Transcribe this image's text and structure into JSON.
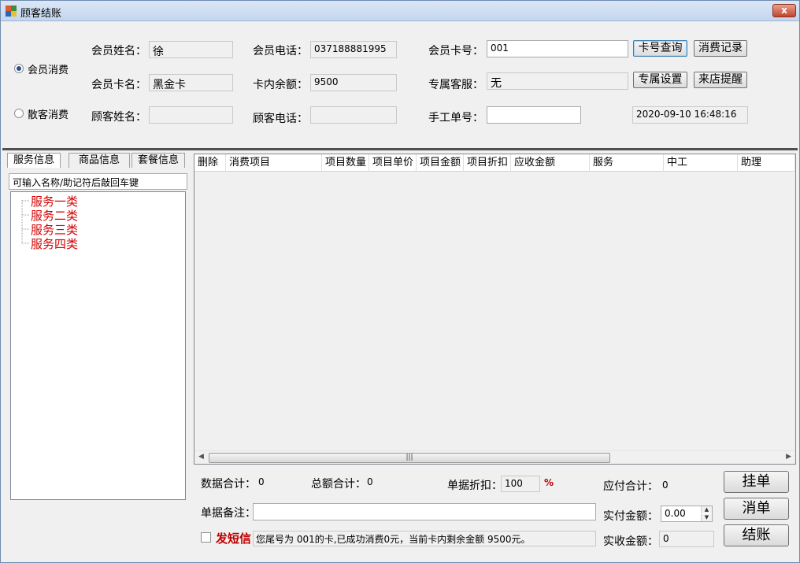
{
  "window": {
    "title": "顾客结账",
    "close_label": "x"
  },
  "mode": {
    "member_label": "会员消费",
    "walkin_label": "散客消费",
    "selected": "member"
  },
  "member": {
    "name_label": "会员姓名：",
    "name": "徐",
    "phone_label": "会员电话：",
    "phone": "037188881995",
    "card_no_label": "会员卡号：",
    "card_no": "001",
    "card_name_label": "会员卡名：",
    "card_name": "黑金卡",
    "balance_label": "卡内余额：",
    "balance": "9500",
    "service_label": "专属客服：",
    "service": "无"
  },
  "customer": {
    "name_label": "顾客姓名：",
    "name": "",
    "phone_label": "顾客电话：",
    "phone": "",
    "manual_label": "手工单号：",
    "manual": ""
  },
  "buttons": {
    "card_query": "卡号查询",
    "records": "消费记录",
    "exclusive": "专属设置",
    "reminder": "来店提醒",
    "hang": "挂单",
    "clear": "消单",
    "checkout": "结账"
  },
  "datetime": "2020-09-10 16:48:16",
  "tabs": [
    "服务信息",
    "商品信息",
    "套餐信息"
  ],
  "search_hint": "可输入名称/助记符后敲回车键",
  "tree_items": [
    "服务一类",
    "服务二类",
    "服务三类",
    "服务四类"
  ],
  "grid_columns": [
    "删除",
    "消费项目",
    "项目数量",
    "项目单价",
    "项目金额",
    "项目折扣",
    "应收金额",
    "服务",
    "中工",
    "助理"
  ],
  "summary": {
    "data_total_label": "数据合计：",
    "data_total": "0",
    "amount_total_label": "总额合计：",
    "amount_total": "0",
    "discount_label": "单据折扣：",
    "discount": "100",
    "percent": "%",
    "payable_label": "应付合计：",
    "payable": "0",
    "remark_label": "单据备注：",
    "remark": "",
    "paid_label": "实付金额：",
    "paid": "0.00",
    "received_label": "实收金额：",
    "received": "0"
  },
  "sms": {
    "label": "发短信",
    "text": "您尾号为 001的卡,已成功消费0元，当前卡内剩余金额 9500元。",
    "checked": false
  },
  "colors": {
    "tree_text": "#d40000",
    "sms_label": "#c00000",
    "percent": "#c00000"
  }
}
